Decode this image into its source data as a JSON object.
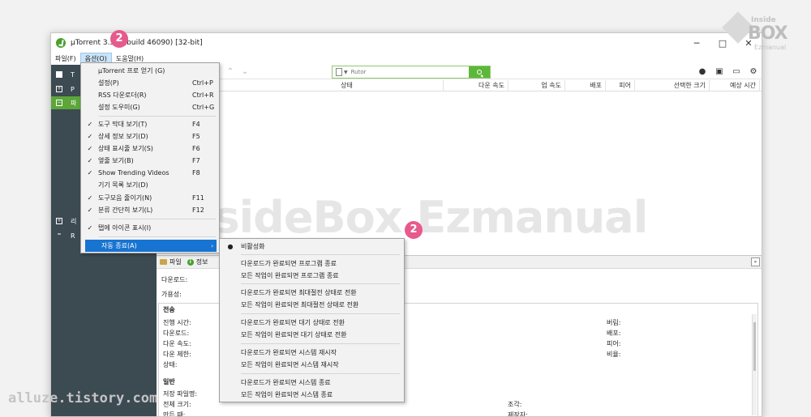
{
  "window": {
    "title": "µTorrent 3.5.5 (build 46090) [32-bit]",
    "controls": [
      "─",
      "□",
      "✕"
    ]
  },
  "menubar": {
    "items": [
      "파일(F)",
      "옵션(O)",
      "도움말(H)"
    ]
  },
  "toolbar": {
    "search_placeholder": "Rutor",
    "icons": [
      "download-icon",
      "stop-icon",
      "up-icon",
      "down-icon",
      "bulb-icon",
      "chat-icon",
      "monitor-icon",
      "gear-icon"
    ]
  },
  "sidebar": {
    "rows": [
      {
        "label": "T",
        "type": "header"
      },
      {
        "label": "P",
        "type": "item"
      },
      {
        "label": "파",
        "type": "selected"
      },
      {
        "label": "리",
        "type": "item"
      },
      {
        "label": "R",
        "type": "item"
      }
    ]
  },
  "columns": [
    "상태",
    "다운 속도",
    "업 속도",
    "배포",
    "피어",
    "선택한 크기",
    "예상 시간"
  ],
  "options_menu": {
    "items": [
      {
        "check": "",
        "label": "µTorrent 프로 얻기 (G)",
        "shortcut": ""
      },
      {
        "check": "",
        "label": "설정(P)",
        "shortcut": "Ctrl+P"
      },
      {
        "check": "",
        "label": "RSS 다운로더(R)",
        "shortcut": "Ctrl+R"
      },
      {
        "check": "",
        "label": "설정 도우미(G)",
        "shortcut": "Ctrl+G"
      },
      {
        "check": "✓",
        "label": "도구 막대 보기(T)",
        "shortcut": "F4"
      },
      {
        "check": "✓",
        "label": "상세 정보 보기(D)",
        "shortcut": "F5"
      },
      {
        "check": "✓",
        "label": "상태 표시줄 보기(S)",
        "shortcut": "F6"
      },
      {
        "check": "✓",
        "label": "옆줄 보기(B)",
        "shortcut": "F7"
      },
      {
        "check": "✓",
        "label": "Show Trending Videos",
        "shortcut": "F8"
      },
      {
        "check": "",
        "label": "기기 목록 보기(D)",
        "shortcut": ""
      },
      {
        "check": "✓",
        "label": "도구모음 줄이기(N)",
        "shortcut": "F11"
      },
      {
        "check": "✓",
        "label": "분류 간단히 보기(L)",
        "shortcut": "F12"
      },
      {
        "check": "✓",
        "label": "탭에 아이콘 표시(I)",
        "shortcut": ""
      },
      {
        "check": "",
        "label": "자동 종료(A)",
        "shortcut": ""
      }
    ]
  },
  "auto_shutdown_submenu": {
    "items": [
      {
        "mark": "●",
        "label": "비활성화"
      },
      {
        "mark": "",
        "label": "다운로드가 완료되면 프로그램 종료"
      },
      {
        "mark": "",
        "label": "모든 작업이 완료되면 프로그램 종료"
      },
      {
        "mark": "",
        "label": "다운로드가 완료되면 최대절전 상태로 전환"
      },
      {
        "mark": "",
        "label": "모든 작업이 완료되면 최대절전 상태로 전환"
      },
      {
        "mark": "",
        "label": "다운로드가 완료되면 대기 상태로 전환"
      },
      {
        "mark": "",
        "label": "모든 작업이 완료되면 대기 상태로 전환"
      },
      {
        "mark": "",
        "label": "다운로드가 완료되면 시스템 재시작"
      },
      {
        "mark": "",
        "label": "모든 작업이 완료되면 시스템 재시작"
      },
      {
        "mark": "",
        "label": "다운로드가 완료되면 시스템 종료"
      },
      {
        "mark": "",
        "label": "모든 작업이 완료되면 시스템 종료"
      }
    ]
  },
  "detail_pane": {
    "tabs": [
      "파일",
      "정보"
    ],
    "collapse": "»",
    "labels": {
      "download": "다운로드:",
      "availability": "가용성:",
      "transfer_header": "전송",
      "elapsed": "진행 시간:",
      "downloaded": "다운로드:",
      "down_speed": "다운 속도:",
      "down_limit": "다운 제한:",
      "status": "상태:",
      "wasted": "버림:",
      "seeds": "배포:",
      "peers": "피어:",
      "ratio": "비율:",
      "general_header": "일반",
      "save_as": "저장 파일명:",
      "total_size": "전체 크기:",
      "created_on": "만든 때:",
      "pieces": "조각:",
      "created_by": "제작자:"
    }
  },
  "watermark": "InsideBox Ezmanual",
  "badges": [
    "2",
    "2"
  ],
  "corner_logo": {
    "line1": "Inside",
    "line2": "BOX",
    "line3": "Ezmanual"
  },
  "footer_watermark": "alluze.tistory.com",
  "colors": {
    "accent_green": "#5db83a",
    "sidebar": "#3c4a52",
    "highlight": "#1874d2",
    "badge": "#e75a8c"
  }
}
